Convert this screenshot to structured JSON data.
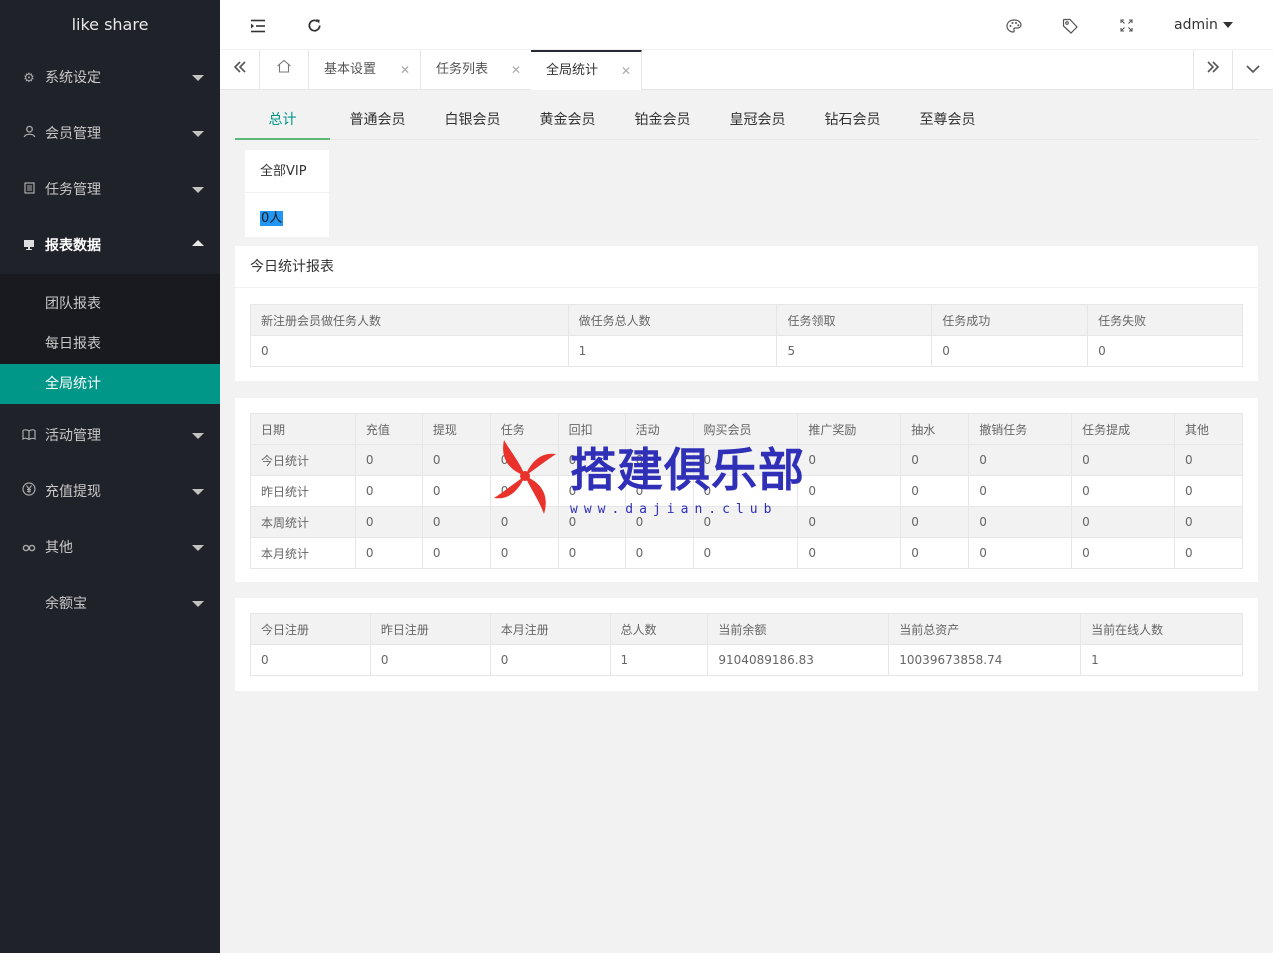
{
  "app": {
    "logo": "like share"
  },
  "sidebar": {
    "items": [
      {
        "label": "系统设定",
        "icon": "gear-icon"
      },
      {
        "label": "会员管理",
        "icon": "user-icon"
      },
      {
        "label": "任务管理",
        "icon": "document-icon"
      },
      {
        "label": "报表数据",
        "icon": "monitor-icon"
      },
      {
        "label": "活动管理",
        "icon": "book-icon"
      },
      {
        "label": "充值提现",
        "icon": "yen-icon"
      },
      {
        "label": "其他",
        "icon": "link-icon"
      },
      {
        "label": "余额宝",
        "icon": ""
      }
    ],
    "subitems": [
      "团队报表",
      "每日报表",
      "全局统计"
    ]
  },
  "header": {
    "user": "admin",
    "icons": [
      "menu-fold-icon",
      "refresh-icon",
      "palette-icon",
      "tag-icon",
      "fullscreen-icon"
    ]
  },
  "tabs": [
    {
      "label": "基本设置"
    },
    {
      "label": "任务列表"
    },
    {
      "label": "全局统计"
    }
  ],
  "member_tabs": [
    "总计",
    "普通会员",
    "白银会员",
    "黄金会员",
    "铂金会员",
    "皇冠会员",
    "钻石会员",
    "至尊会员"
  ],
  "vip_card": {
    "title": "全部VIP",
    "value": "0人"
  },
  "today_report": {
    "title": "今日统计报表",
    "headers": [
      "新注册会员做任务人数",
      "做任务总人数",
      "任务领取",
      "任务成功",
      "任务失败"
    ],
    "row": [
      "0",
      "1",
      "5",
      "0",
      "0"
    ]
  },
  "period_stats": {
    "headers": [
      "日期",
      "充值",
      "提现",
      "任务",
      "回扣",
      "活动",
      "购买会员",
      "推广奖励",
      "抽水",
      "撤销任务",
      "任务提成",
      "其他"
    ],
    "rows": [
      [
        "今日统计",
        "0",
        "0",
        "0",
        "0",
        "0",
        "0",
        "0",
        "0",
        "0",
        "0",
        "0"
      ],
      [
        "昨日统计",
        "0",
        "0",
        "0",
        "0",
        "0",
        "0",
        "0",
        "0",
        "0",
        "0",
        "0"
      ],
      [
        "本周统计",
        "0",
        "0",
        "0",
        "0",
        "0",
        "0",
        "0",
        "0",
        "0",
        "0",
        "0"
      ],
      [
        "本月统计",
        "0",
        "0",
        "0",
        "0",
        "0",
        "0",
        "0",
        "0",
        "0",
        "0",
        "0"
      ]
    ]
  },
  "summary": {
    "headers": [
      "今日注册",
      "昨日注册",
      "本月注册",
      "总人数",
      "当前余额",
      "当前总资产",
      "当前在线人数"
    ],
    "row": [
      "0",
      "0",
      "0",
      "1",
      "9104089186.83",
      "10039673858.74",
      "1"
    ]
  },
  "watermark": {
    "text": "搭建俱乐部",
    "url": "www.dajian.club"
  },
  "colors": {
    "sidebar_bg": "#20222a",
    "accent": "#009688",
    "watermark": "#2f2fb8",
    "watermark_logo": "#e8322b"
  }
}
